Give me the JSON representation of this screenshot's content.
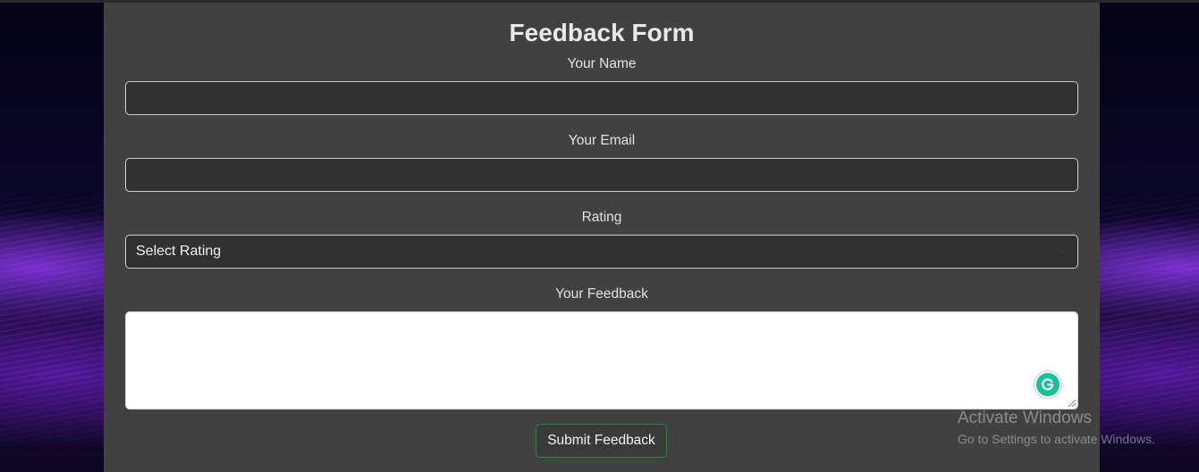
{
  "form": {
    "title": "Feedback Form",
    "name_label": "Your Name",
    "name_value": "",
    "email_label": "Your Email",
    "email_value": "",
    "rating_label": "Rating",
    "rating_selected": "Select Rating",
    "feedback_label": "Your Feedback",
    "feedback_value": "",
    "submit_label": "Submit Feedback"
  },
  "overlay": {
    "grammarly_icon": "grammarly-icon",
    "watermark_title": "Activate Windows",
    "watermark_sub": "Go to Settings to activate Windows."
  },
  "colors": {
    "panel": "#414141",
    "input_bg": "#303030",
    "submit_border": "#1e8a4a",
    "grammarly": "#15c39a"
  }
}
